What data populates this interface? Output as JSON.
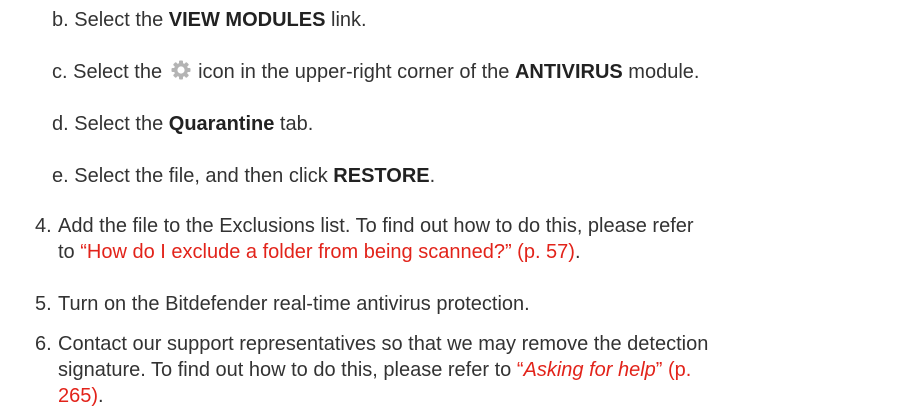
{
  "steps": {
    "b": {
      "marker": "b.",
      "pre": "Select the",
      "bold": "VIEW MODULES",
      "post": "link."
    },
    "c": {
      "marker": "c.",
      "pre": "Select the",
      "icon": "gear-icon",
      "mid": "icon in the upper-right corner of the",
      "bold": "ANTIVIRUS",
      "post": "module."
    },
    "d": {
      "marker": "d.",
      "pre": "Select the",
      "bold": "Quarantine",
      "post": "tab."
    },
    "e": {
      "marker": "e.",
      "pre": "Select the file, and then click",
      "bold": "RESTORE",
      "post": "."
    },
    "s4": {
      "marker": "4.",
      "line1": "Add the file to the Exclusions list. To find out how to do this, please refer",
      "line2_pre": "to",
      "link": "“How do I exclude a folder from being scanned?” (p. 57)",
      "line2_post": "."
    },
    "s5": {
      "marker": "5.",
      "text": "Turn on the Bitdefender real-time antivirus protection."
    },
    "s6": {
      "marker": "6.",
      "line1": "Contact our support representatives so that we may remove the detection",
      "line2_pre": "signature. To find out how to do this, please refer to",
      "link_open": "“",
      "link_italic": "Asking for help",
      "link_close": "” (p.",
      "line3_link": "265)",
      "line3_post": "."
    }
  },
  "colors": {
    "text": "#333333",
    "link": "#e2231a",
    "icon": "#b4b4b4"
  }
}
